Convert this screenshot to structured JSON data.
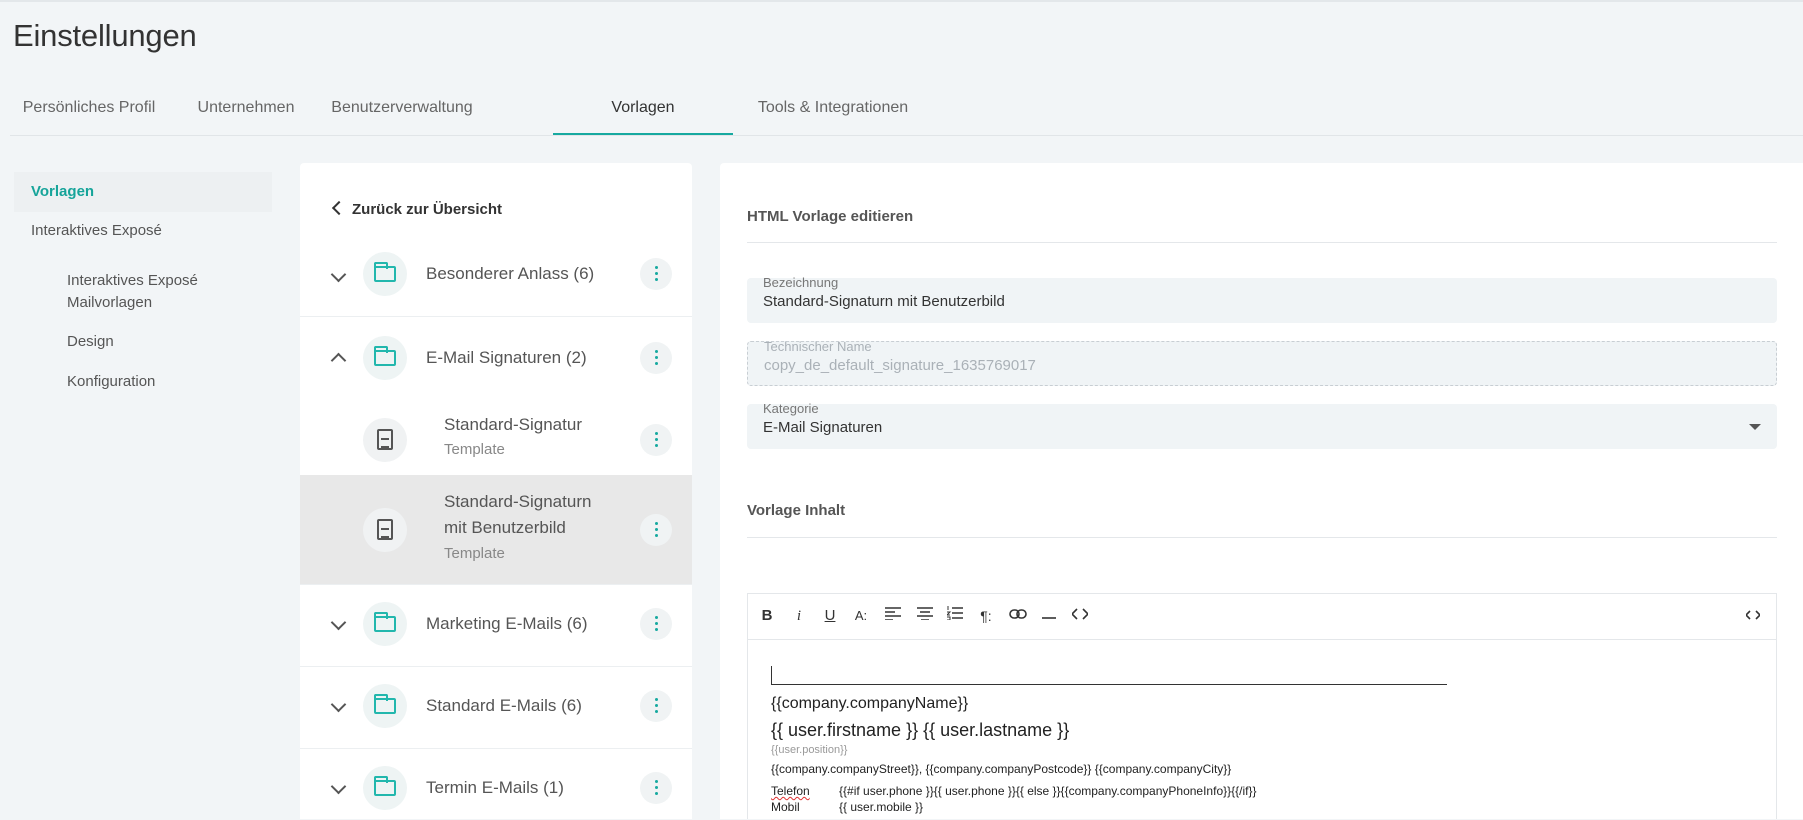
{
  "page_title": "Einstellungen",
  "tabs": [
    "Persönliches Profil",
    "Unternehmen",
    "Benutzerverwaltung",
    "Vorlagen",
    "Tools & Integrationen"
  ],
  "active_tab": "Vorlagen",
  "leftnav": {
    "items": [
      "Vorlagen",
      "Interaktives Exposé"
    ],
    "subitems": [
      "Interaktives Exposé Mailvorlagen",
      "Design",
      "Konfiguration"
    ]
  },
  "middle": {
    "back_label": "Zurück zur Übersicht",
    "rows": [
      {
        "label": "Besonderer Anlass (6)"
      },
      {
        "label": "E-Mail Signaturen (2)"
      },
      {
        "label": "Standard-Signatur",
        "sub": "Template"
      },
      {
        "label": "Standard-Signaturn mit Benutzerbild",
        "line1": "Standard-Signaturn",
        "line2": "mit Benutzerbild",
        "sub": "Template"
      },
      {
        "label": "Marketing E-Mails (6)"
      },
      {
        "label": "Standard E-Mails (6)"
      },
      {
        "label": "Termin E-Mails (1)"
      }
    ]
  },
  "editor": {
    "section_title": "HTML Vorlage editieren",
    "fields": {
      "bezeichnung": {
        "label": "Bezeichnung",
        "value": "Standard-Signaturn mit Benutzerbild"
      },
      "technischer_name": {
        "label": "Technischer Name",
        "value": "copy_de_default_signature_1635769017"
      },
      "kategorie": {
        "label": "Kategorie",
        "value": "E-Mail Signaturen"
      }
    },
    "content_title": "Vorlage Inhalt",
    "toolbar": [
      "B",
      "i",
      "U",
      "A:",
      "align-left",
      "align-center",
      "list-ordered",
      "paragraph",
      "link",
      "hr",
      "code",
      "source"
    ],
    "body_lines": {
      "company_name": "{{company.companyName}}",
      "user_name": "{{ user.firstname }} {{ user.lastname }}",
      "position": "{{user.position}}",
      "address": "{{company.companyStreet}}, {{company.companyPostcode}} {{company.companyCity}}",
      "telefon_label": "Telefon",
      "telefon_value": "{{#if user.phone }}{{ user.phone }}{{ else }}{{company.companyPhoneInfo}}{{/if}}",
      "mobil_label": "Mobil",
      "mobil_value": "{{ user.mobile }}"
    }
  }
}
